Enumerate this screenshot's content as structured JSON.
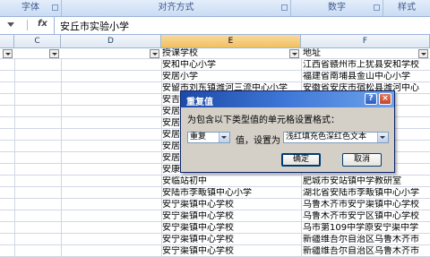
{
  "ribbon": {
    "groups": [
      "字体",
      "对齐方式",
      "数字",
      "样式"
    ]
  },
  "formula_bar": {
    "fx_label": "fx",
    "value": "安丘市实验小学"
  },
  "columns": {
    "headers": [
      "C",
      "D",
      "E",
      "F"
    ]
  },
  "sheet": {
    "header_row": {
      "col_e": "授课学校",
      "col_f": "地址"
    },
    "rows": [
      {
        "col_e": "安和中心小学",
        "col_f": "江西省赣州市上犹县安和学校"
      },
      {
        "col_e": "安居小学",
        "col_f": "福建省南埔县金山中心小学"
      },
      {
        "col_e": "安留市刘东镇潍河三流中心小学",
        "col_f": "安徽省安庆市宿松县潍河中心"
      },
      {
        "col_e": "安吉",
        "col_f": ""
      },
      {
        "col_e": "安居",
        "col_f": "学校"
      },
      {
        "col_e": "安居",
        "col_f": "初级中"
      },
      {
        "col_e": "安居",
        "col_f": "初级中"
      },
      {
        "col_e": "安居",
        "col_f": "中学校"
      },
      {
        "col_e": "安居",
        "col_f": "中学校"
      },
      {
        "col_e": "安康市第一小学",
        "col_f": "陕西省安康市中学"
      },
      {
        "col_e": "安临站初中",
        "col_f": "肥城市安站镇中学教研室"
      },
      {
        "col_e": "安陆市李畈镇中心小学",
        "col_f": "湖北省安陆市李畈镇中心小学"
      },
      {
        "col_e": "安宁渠镇中心学校",
        "col_f": "乌鲁木齐市安宁渠镇中心学校"
      },
      {
        "col_e": "安宁渠镇中心学校",
        "col_f": "乌鲁木齐市安宁区镇中心学校"
      },
      {
        "col_e": "安宁渠镇中心学校",
        "col_f": "乌市第109中学原安宁渠中学"
      },
      {
        "col_e": "安宁渠镇中心学校",
        "col_f": "新疆维吾尔自治区乌鲁木齐市"
      },
      {
        "col_e": "安宁渠镇中心学校",
        "col_f": "新疆维吾尔自治区乌鲁木齐市"
      }
    ]
  },
  "dialog": {
    "title": "重复值",
    "help_glyph": "?",
    "close_glyph": "×",
    "prompt": "为包含以下类型值的单元格设置格式：",
    "type_value": "重复",
    "label_value": "值，设置为",
    "format_value": "浅红填充色深红色文本",
    "ok_label": "确定",
    "cancel_label": "取消"
  }
}
